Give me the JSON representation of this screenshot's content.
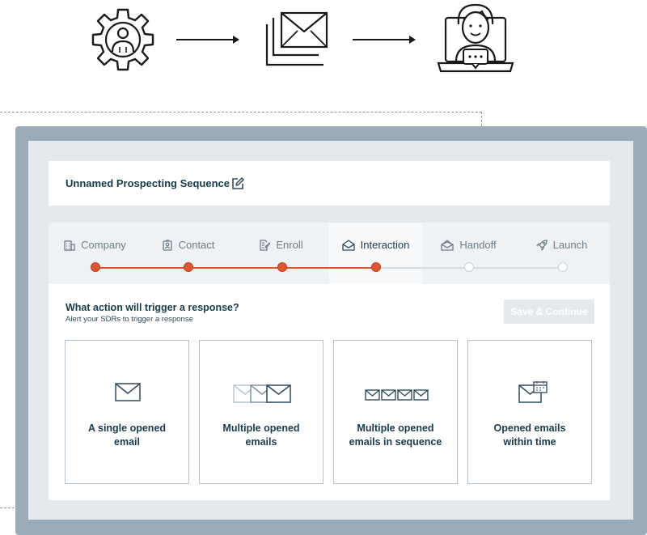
{
  "sequence": {
    "title": "Unnamed Prospecting Sequence"
  },
  "steps": [
    {
      "label": "Company",
      "icon": "building-icon",
      "state": "done"
    },
    {
      "label": "Contact",
      "icon": "contact-card-icon",
      "state": "done"
    },
    {
      "label": "Enroll",
      "icon": "clipboard-icon",
      "state": "done"
    },
    {
      "label": "Interaction",
      "icon": "open-envelope-icon",
      "state": "current"
    },
    {
      "label": "Handoff",
      "icon": "envelope-stack-icon",
      "state": "todo"
    },
    {
      "label": "Launch",
      "icon": "rocket-icon",
      "state": "todo"
    }
  ],
  "question": {
    "title": "What action will trigger a response?",
    "hint": "Alert your SDRs to trigger a response"
  },
  "save_label": "Save & Continue",
  "cards": [
    {
      "line1": "A single opened",
      "line2": "email",
      "icon": "single-email-icon"
    },
    {
      "line1": "Multiple opened",
      "line2": "emails",
      "icon": "multiple-emails-icon"
    },
    {
      "line1": "Multiple opened",
      "line2": "emails in sequence",
      "icon": "sequence-emails-icon"
    },
    {
      "line1": "Opened emails",
      "line2": "within time",
      "icon": "email-calendar-icon"
    }
  ],
  "colors": {
    "accent": "#e0572f",
    "frame": "#9aabb9",
    "text": "#183a4c",
    "inactive": "#6c7e89"
  }
}
